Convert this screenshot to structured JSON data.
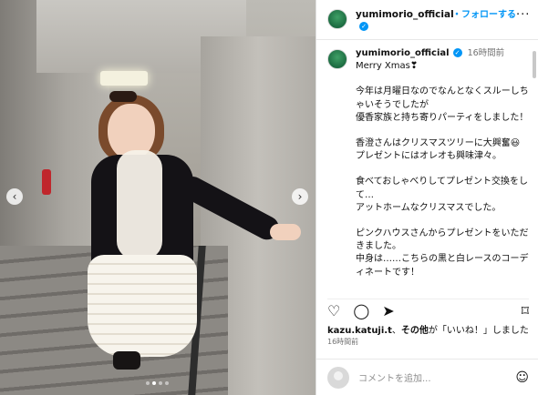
{
  "header": {
    "username": "yumimorio_official",
    "follow_label": "・フォローする",
    "more_icon": "more-icon"
  },
  "caption": {
    "username": "yumimorio_official",
    "time": "16時間前",
    "paragraphs": [
      "Merry Xmas❣",
      "今年は月曜日なのでなんとなくスルーしちゃいそうでしたが\n優香家族と持ち寄りパーティをしました！",
      "香澄さんはクリスマスツリーに大興奮😃\nプレゼントにはオレオも興味津々。",
      "食べておしゃべりしてプレゼント交換をして…\nアットホームなクリスマスでした。",
      "ピンクハウスさんからプレゼントをいただきました。\n中身は……こちらの黒と白レースのコーディネートです！"
    ]
  },
  "photo": {
    "prev_icon": "‹",
    "next_icon": "›",
    "slide_count": 4,
    "active_slide": 1
  },
  "actions": {
    "heart_icon": "♡",
    "comment_icon": "◯",
    "share_icon": "➤",
    "bookmark_icon": "⌑"
  },
  "likes": {
    "user": "kazu.katuji.t",
    "connector": "、",
    "others": "その他",
    "suffix": "が「いいね！」しました"
  },
  "post_time": "16時間前",
  "comment": {
    "placeholder": "コメントを追加...",
    "emoji_icon": "☺"
  }
}
